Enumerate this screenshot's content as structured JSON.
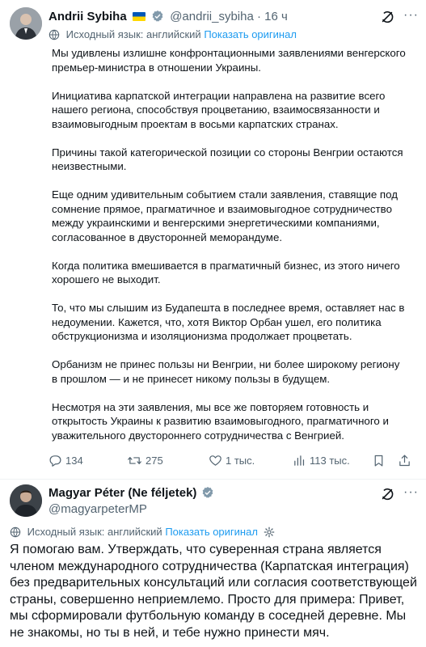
{
  "tweet1": {
    "author_name": "Andrii Sybiha",
    "handle": "@andrii_sybiha",
    "separator": "·",
    "time": "16 ч",
    "translate_label": "Исходный язык: английский",
    "translate_link": "Показать оригинал",
    "paragraphs": [
      "Мы удивлены излишне конфронтационными заявлениями венгерского премьер-министра в отношении Украины.",
      "Инициатива карпатской интеграции направлена на развитие всего нашего региона, способствуя процветанию, взаимосвязанности и взаимовыгодным проектам в восьми карпатских странах.",
      "Причины такой категорической позиции со стороны Венгрии остаются неизвестными.",
      "Еще одним удивительным событием стали заявления, ставящие под сомнение прямое, прагматичное и взаимовыгодное сотрудничество между украинскими и венгерскими энергетическими компаниями, согласованное в двусторонней меморандуме.",
      "Когда политика вмешивается в прагматичный бизнес, из этого ничего хорошего не выходит.",
      "То, что мы слышим из Будапешта в последнее время, оставляет нас в недоумении. Кажется, что, хотя Виктор Орбан ушел, его политика обструкционизма и изоляционизма продолжает процветать.",
      "Орбанизм не принес пользы ни Венгрии, ни более широкому региону в прошлом — и не принесет никому пользы в будущем.",
      "Несмотря на эти заявления, мы все же повторяем готовность и открытость Украины к развитию взаимовыгодного, прагматичного и уважительного двустороннего сотрудничества с Венгрией."
    ],
    "actions": {
      "replies": "134",
      "reposts": "275",
      "likes": "1 тыс.",
      "views": "113 тыс."
    }
  },
  "tweet2": {
    "author_name": "Magyar Péter (Ne féljetek)",
    "handle": "@magyarpeterMP",
    "translate_label": "Исходный язык: английский",
    "translate_link": "Показать оригинал",
    "text": "Я помогаю вам. Утверждать, что суверенная страна является членом международного сотрудничества (Карпатская интеграция) без предварительных консультаций или согласия соответствующей страны, совершенно неприемлемо. Просто для примера: Привет, мы сформировали футбольную команду в соседней деревне. Мы не знакомы, но ты в ней, и тебе нужно принести мяч."
  },
  "colors": {
    "link": "#1d9bf0",
    "verified": "#829aab",
    "muted": "#536471",
    "flag_blue": "#0057b7",
    "flag_yellow": "#ffd700"
  },
  "icons": [
    "globe-icon",
    "verified-badge-icon",
    "grok-icon",
    "more-icon",
    "reply-icon",
    "repost-icon",
    "like-icon",
    "views-icon",
    "bookmark-icon",
    "share-icon",
    "gear-icon",
    "ukraine-flag-icon"
  ]
}
